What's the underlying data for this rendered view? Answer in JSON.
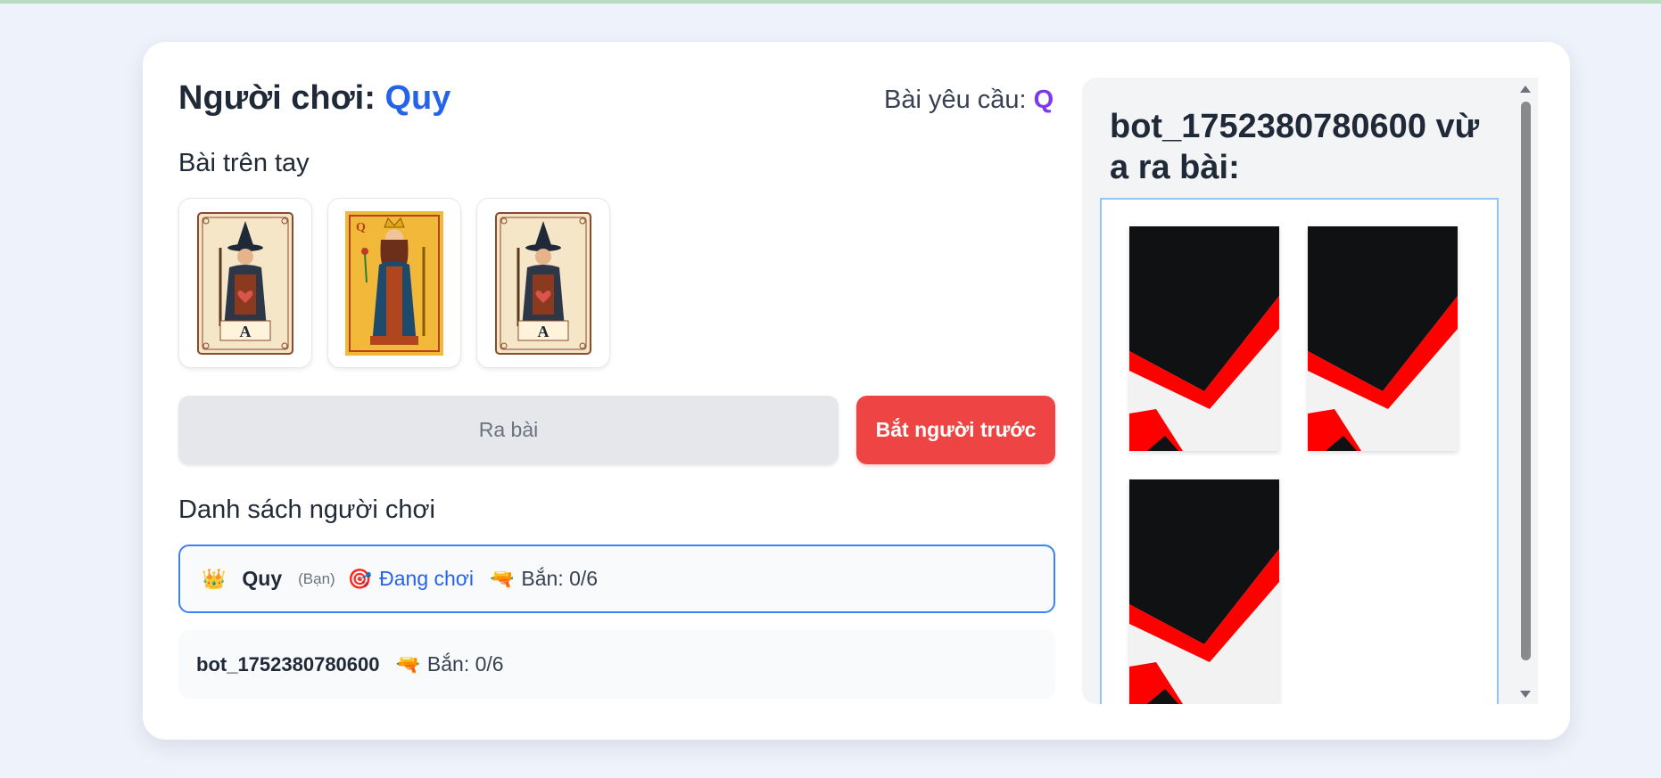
{
  "header": {
    "player_label": "Người chơi:",
    "player_name": "Quy",
    "required_label": "Bài yêu cầu:",
    "required_value": "Q"
  },
  "hand": {
    "title": "Bài trên tay",
    "cards": [
      {
        "rank": "A",
        "icon": "ace-card-icon"
      },
      {
        "rank": "Q",
        "icon": "queen-card-icon"
      },
      {
        "rank": "A",
        "icon": "ace-card-icon"
      }
    ]
  },
  "actions": {
    "play_label": "Ra bài",
    "catch_label": "Bắt người trước"
  },
  "players": {
    "title": "Danh sách người chơi",
    "list": [
      {
        "icon": "crown-icon",
        "name": "Quy",
        "you_tag": "(Bạn)",
        "status_icon": "target-icon",
        "status": "Đang chơi",
        "shot_icon": "water-gun-icon",
        "shots": "Bắn: 0/6"
      },
      {
        "name": "bot_1752380780600",
        "shot_icon": "water-gun-icon",
        "shots": "Bắn: 0/6"
      }
    ]
  },
  "played_panel": {
    "player": "bot_1752380780600",
    "suffix": "vừa ra bài:",
    "card_backs": 3
  },
  "colors": {
    "accent_blue": "#2563eb",
    "accent_purple": "#7c3aed",
    "danger_red": "#ef4444",
    "card_back_red": "#ff0000",
    "card_back_black": "#0f1112"
  }
}
